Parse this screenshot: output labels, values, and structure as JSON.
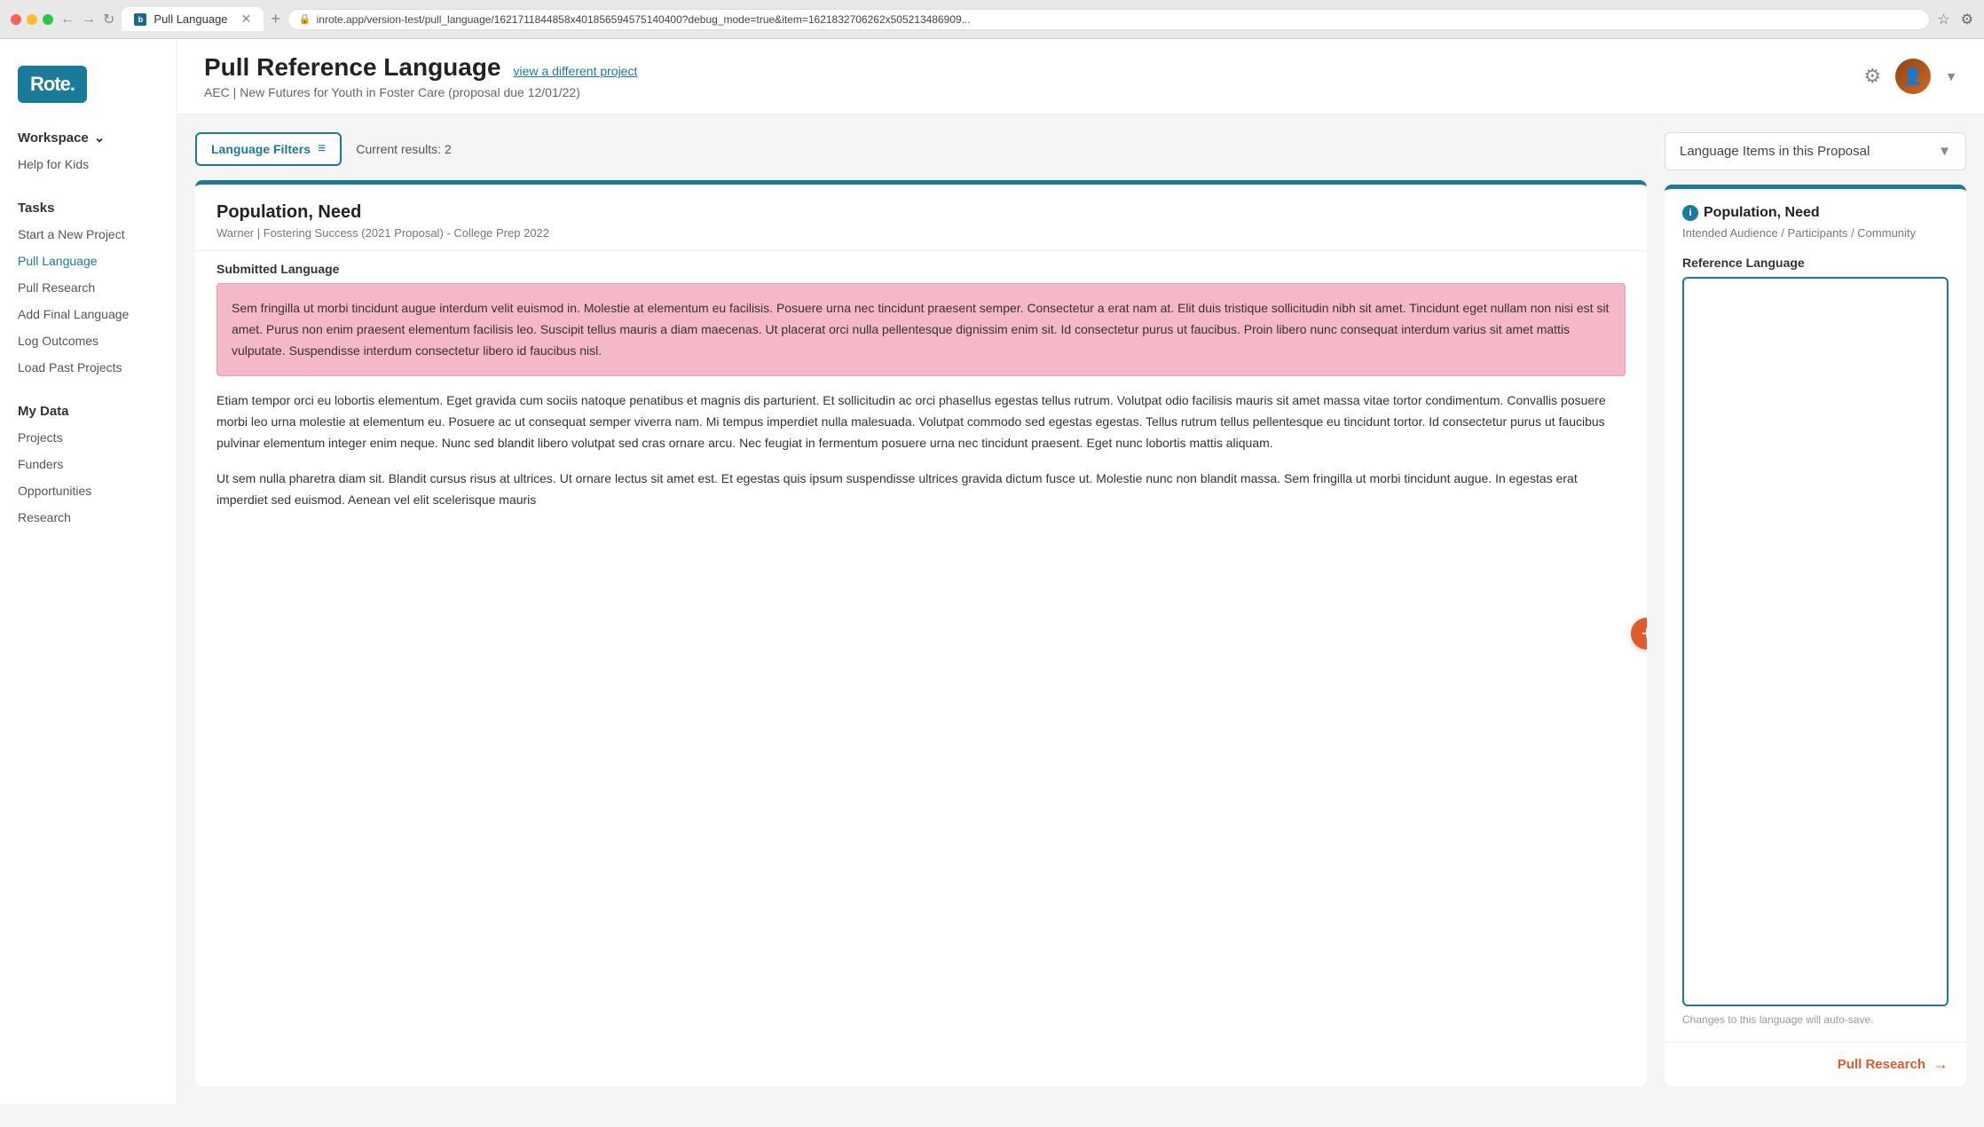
{
  "browser": {
    "tab_title": "Pull Language",
    "url": "inrote.app/version-test/pull_language/1621711844858x401856594575140400?debug_mode=true&item=1621832706262x505213486909...",
    "favicon_text": "b"
  },
  "header": {
    "title": "Pull Reference Language",
    "view_link": "view a different project",
    "subtitle": "AEC | New Futures for Youth in Foster Care (proposal due 12/01/22)",
    "logo_text": "Rote."
  },
  "sidebar": {
    "workspace_label": "Workspace",
    "workspace_sub": "Help for Kids",
    "tasks_label": "Tasks",
    "task_items": [
      "Start a New Project",
      "Pull Language",
      "Pull Research",
      "Add Final Language",
      "Log Outcomes",
      "Load Past Projects"
    ],
    "my_data_label": "My Data",
    "my_data_items": [
      "Projects",
      "Funders",
      "Opportunities",
      "Research"
    ]
  },
  "filter_bar": {
    "filters_label": "Language Filters",
    "current_results": "Current results: 2"
  },
  "document": {
    "title": "Population, Need",
    "subtitle": "Warner | Fostering Success (2021 Proposal) - College Prep 2022",
    "section_label": "Submitted Language",
    "highlighted_paragraph": "Sem fringilla ut morbi tincidunt augue interdum velit euismod in. Molestie at elementum eu facilisis. Posuere urna nec tincidunt praesent semper. Consectetur a erat nam at. Elit duis tristique sollicitudin nibh sit amet. Tincidunt eget nullam non nisi est sit amet. Purus non enim praesent elementum facilisis leo. Suscipit tellus mauris a diam maecenas. Ut placerat orci nulla pellentesque dignissim enim sit. Id consectetur purus ut faucibus. Proin libero nunc consequat interdum varius sit amet mattis vulputate. Suspendisse interdum consectetur libero id faucibus nisl.",
    "paragraph2": "Etiam tempor orci eu lobortis elementum. Eget gravida cum sociis natoque penatibus et magnis dis parturient. Et sollicitudin ac orci phasellus egestas tellus rutrum. Volutpat odio facilisis mauris sit amet massa vitae tortor condimentum. Convallis posuere morbi leo urna molestie at elementum eu. Posuere ac ut consequat semper viverra nam. Mi tempus imperdiet nulla malesuada. Volutpat commodo sed egestas egestas. Tellus rutrum tellus pellentesque eu tincidunt tortor. Id consectetur purus ut faucibus pulvinar elementum integer enim neque. Nunc sed blandit libero volutpat sed cras ornare arcu. Nec feugiat in fermentum posuere urna nec tincidunt praesent. Eget nunc lobortis mattis aliquam.",
    "paragraph3": "Ut sem nulla pharetra diam sit. Blandit cursus risus at ultrices. Ut ornare lectus sit amet est. Et egestas quis ipsum suspendisse ultrices gravida dictum fusce ut. Molestie nunc non blandit massa. Sem fringilla ut morbi tincidunt augue. In egestas erat imperdiet sed euismod. Aenean vel elit scelerisque mauris"
  },
  "right_panel": {
    "dropdown_label": "Language Items in this Proposal",
    "proposal_title": "Population, Need",
    "proposal_subtitle": "Intended Audience / Participants / Community",
    "ref_lang_label": "Reference Language",
    "ref_lang_value": "",
    "ref_lang_placeholder": "",
    "autosave_note": "Changes to this language will auto-save.",
    "pull_research_label": "Pull Research"
  }
}
